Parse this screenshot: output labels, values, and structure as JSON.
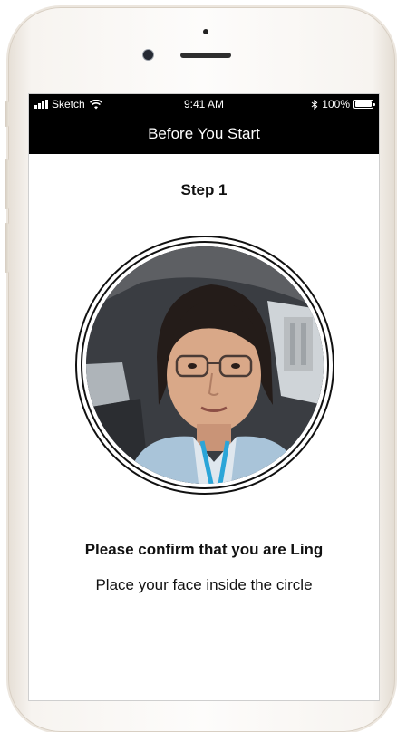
{
  "status_bar": {
    "carrier": "Sketch",
    "time": "9:41 AM",
    "battery": "100%"
  },
  "nav": {
    "title": "Before You Start"
  },
  "step": {
    "title": "Step 1"
  },
  "prompt": {
    "confirm": "Please confirm that you are Ling",
    "instruction": "Place your face inside the circle"
  },
  "icons": {
    "signal": "signal-bars-icon",
    "wifi": "wifi-icon",
    "bluetooth": "bluetooth-icon",
    "battery": "battery-icon"
  },
  "colors": {
    "bar_background": "#000000",
    "bar_text": "#ffffff",
    "screen_background": "#ffffff",
    "text": "#111111"
  }
}
